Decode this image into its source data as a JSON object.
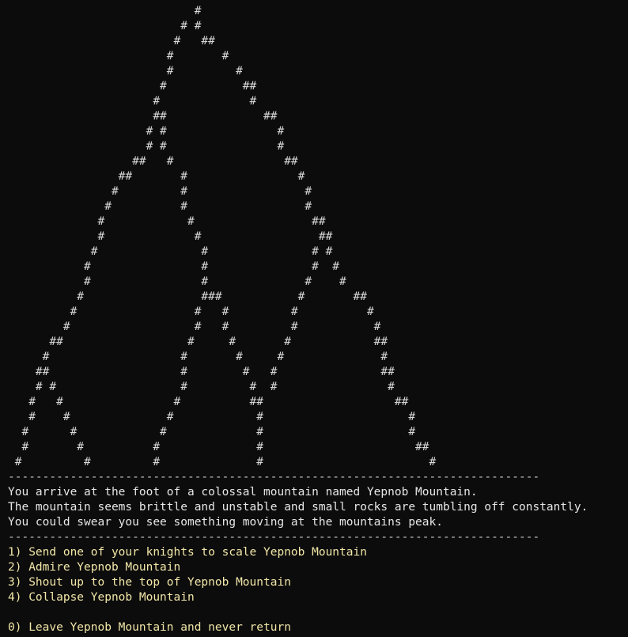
{
  "mountain_art": [
    "                           #",
    "                         # #",
    "                        #   ##",
    "                       #       #",
    "                       #         #",
    "                      #           ##",
    "                     #             #",
    "                     ##              ##",
    "                    # #                #",
    "                    # #                #",
    "                  ##   #                ##",
    "                ##       #                #",
    "               #         #                 #",
    "              #          #                 #",
    "             #            #                 ##",
    "             #             #                 ##",
    "            #               #               # #",
    "           #                #               #  #",
    "           #                #              #    #",
    "          #                 ###           #       ##",
    "         #                 #   #         #          #",
    "        #                  #   #         #           #",
    "      ##                  #     #       #            ##",
    "     #                   #       #     #              #",
    "    ##                   #        #   #               ##",
    "    # #                  #         #  #                #",
    "   #   #                #          ##                   ##",
    "   #    #              #            #                     #",
    "  #      #            #             #                     #",
    "  #       #          #              #                      ##",
    " #         #         #              #                        #"
  ],
  "separator_top": "-----------------------------------------------------------------------------",
  "narration": [
    "You arrive at the foot of a colossal mountain named Yepnob Mountain.",
    "The mountain seems brittle and unstable and small rocks are tumbling off constantly.",
    "You could swear you see something moving at the mountains peak."
  ],
  "separator_bottom": "-----------------------------------------------------------------------------",
  "options": [
    "1) Send one of your knights to scale Yepnob Mountain",
    "2) Admire Yepnob Mountain",
    "3) Shout up to the top of Yepnob Mountain",
    "4) Collapse Yepnob Mountain"
  ],
  "exit_option": "0) Leave Yepnob Mountain and never return"
}
